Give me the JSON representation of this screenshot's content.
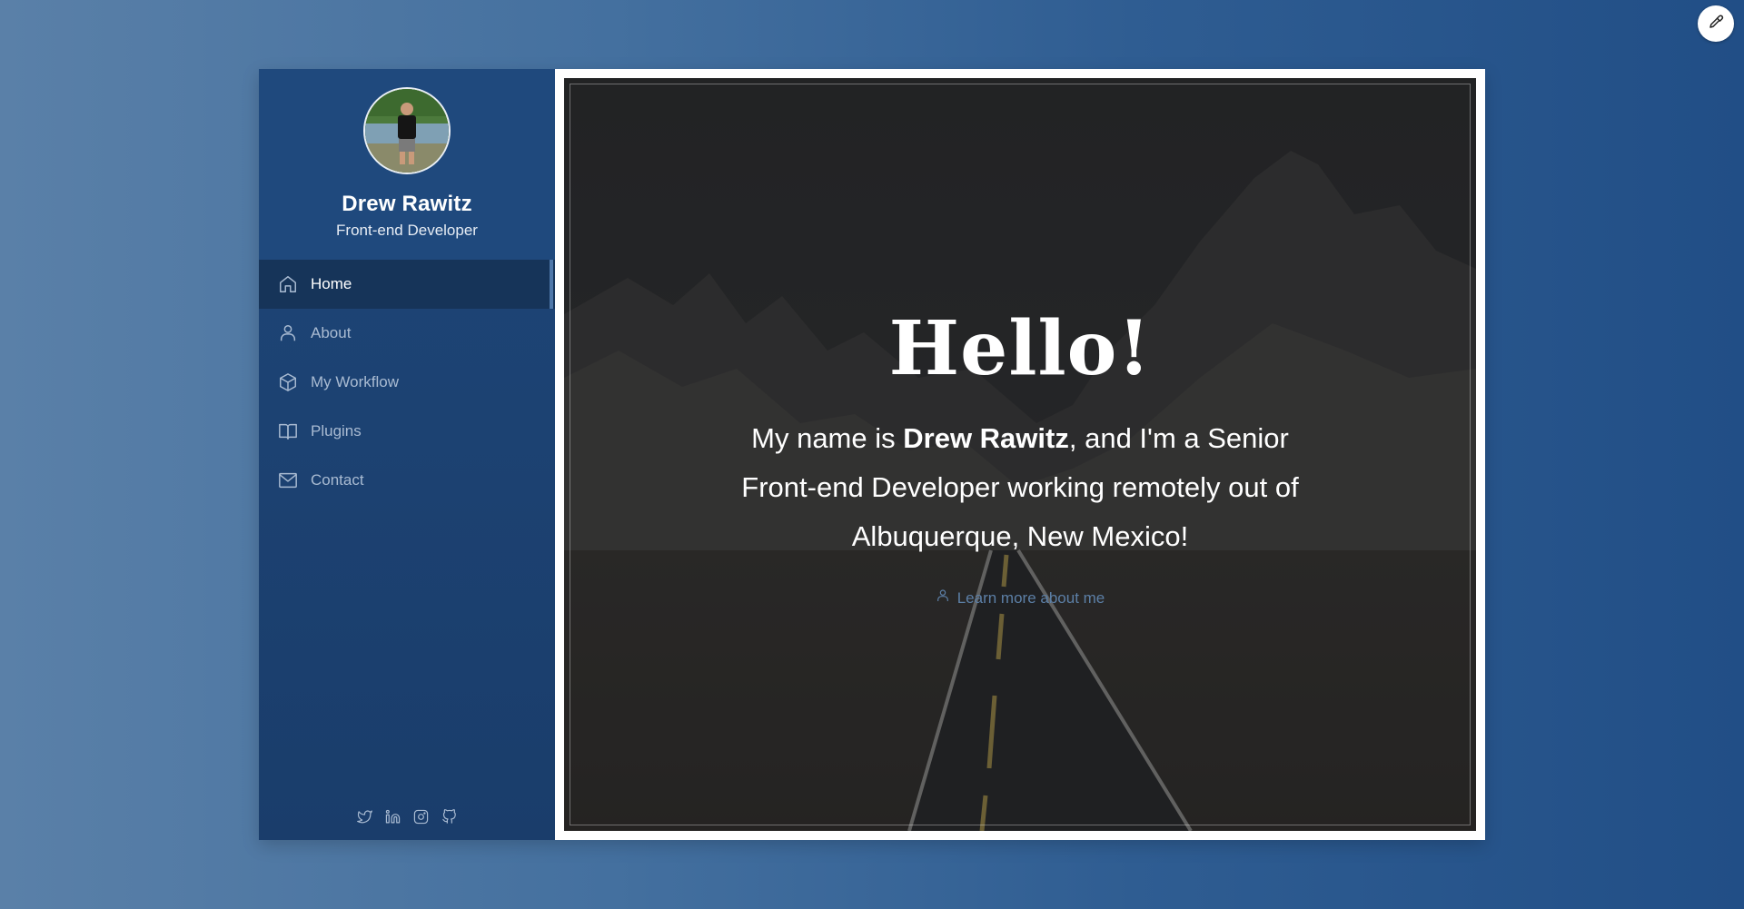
{
  "profile": {
    "name": "Drew Rawitz",
    "role": "Front-end Developer"
  },
  "nav": [
    {
      "label": "Home",
      "icon": "home-icon",
      "active": true
    },
    {
      "label": "About",
      "icon": "user-icon",
      "active": false
    },
    {
      "label": "My Workflow",
      "icon": "box-icon",
      "active": false
    },
    {
      "label": "Plugins",
      "icon": "book-icon",
      "active": false
    },
    {
      "label": "Contact",
      "icon": "mail-icon",
      "active": false
    }
  ],
  "social": [
    "twitter-icon",
    "linkedin-icon",
    "instagram-icon",
    "github-icon"
  ],
  "hero": {
    "heading": "Hello!",
    "intro_prefix": "My name is ",
    "intro_name": "Drew Rawitz",
    "intro_suffix": ", and I'm a Senior Front-end Developer working remotely out of Albuquerque, New Mexico!",
    "link_label": "Learn more about me"
  },
  "colors": {
    "background_start": "#5a80a8",
    "background_end": "#214e86",
    "sidebar": "#1e4678",
    "sidebar_active": "#163459",
    "nav_text": "#a9bbd2",
    "link": "#5c7fa6"
  }
}
